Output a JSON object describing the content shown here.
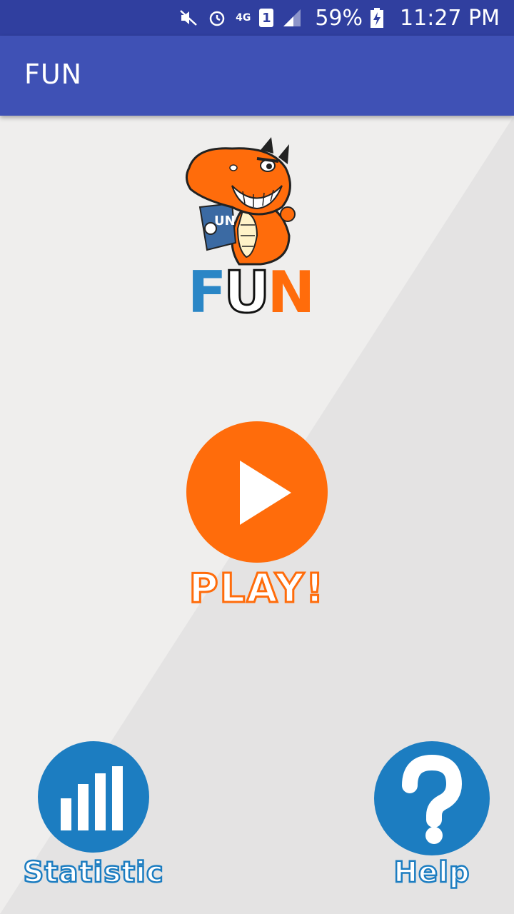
{
  "status_bar": {
    "network": "4G",
    "sim": "1",
    "battery": "59%",
    "time": "11:27 PM"
  },
  "app_bar": {
    "title": "FUN"
  },
  "logo": {
    "letters": [
      "F",
      "U",
      "N"
    ]
  },
  "main": {
    "play_label": "PLAY!",
    "statistic_label": "Statistic",
    "help_label": "Help"
  },
  "colors": {
    "status_bar": "#303f9f",
    "app_bar": "#3f51b5",
    "play": "#ff6c0b",
    "blue_buttons": "#1c7dc1",
    "logo_f": "#2a86c6",
    "logo_n": "#ff6c0b"
  }
}
